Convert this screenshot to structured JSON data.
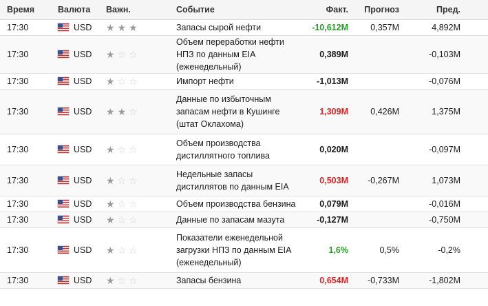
{
  "columns": {
    "time": "Время",
    "currency": "Валюта",
    "importance": "Важн.",
    "event": "Событие",
    "actual": "Факт.",
    "forecast": "Прогноз",
    "previous": "Пред."
  },
  "colors": {
    "up": "#23a023",
    "down": "#e02222",
    "neutral": "#1a1a1a"
  },
  "rows": [
    {
      "time": "17:30",
      "currency": "USD",
      "stars": 3,
      "event": "Запасы сырой нефти",
      "actual": "-10,612M",
      "actual_color": "green",
      "forecast": "0,357M",
      "previous": "4,892M"
    },
    {
      "time": "17:30",
      "currency": "USD",
      "stars": 1,
      "event": "Объем переработки нефти НПЗ по данным EIA (еженедельный)",
      "actual": "0,389M",
      "actual_color": "",
      "forecast": "",
      "previous": "-0,103M"
    },
    {
      "time": "17:30",
      "currency": "USD",
      "stars": 1,
      "event": "Импорт нефти",
      "actual": "-1,013M",
      "actual_color": "",
      "forecast": "",
      "previous": "-0,076M"
    },
    {
      "time": "17:30",
      "currency": "USD",
      "stars": 2,
      "event": "Данные по избыточным запасам нефти в Кушинге (штат Оклахома)",
      "actual": "1,309M",
      "actual_color": "red",
      "forecast": "0,426M",
      "previous": "1,375M"
    },
    {
      "time": "17:30",
      "currency": "USD",
      "stars": 1,
      "event": "Объем производства дистиллятного топлива",
      "actual": "0,020M",
      "actual_color": "",
      "forecast": "",
      "previous": "-0,097M"
    },
    {
      "time": "17:30",
      "currency": "USD",
      "stars": 1,
      "event": "Недельные запасы дистиллятов по данным EIA",
      "actual": "0,503M",
      "actual_color": "red",
      "forecast": "-0,267M",
      "previous": "1,073M"
    },
    {
      "time": "17:30",
      "currency": "USD",
      "stars": 1,
      "event": "Объем производства бензина",
      "actual": "0,079M",
      "actual_color": "",
      "forecast": "",
      "previous": "-0,016M"
    },
    {
      "time": "17:30",
      "currency": "USD",
      "stars": 1,
      "event": "Данные по запасам мазута",
      "actual": "-0,127M",
      "actual_color": "",
      "forecast": "",
      "previous": "-0,750M"
    },
    {
      "time": "17:30",
      "currency": "USD",
      "stars": 1,
      "event": "Показатели еженедельной загрузки НПЗ по данным EIA (еженедельный)",
      "actual": "1,6%",
      "actual_color": "green",
      "forecast": "0,5%",
      "previous": "-0,2%"
    },
    {
      "time": "17:30",
      "currency": "USD",
      "stars": 1,
      "event": "Запасы бензина",
      "actual": "0,654M",
      "actual_color": "red",
      "forecast": "-0,733M",
      "previous": "-1,802M"
    }
  ]
}
